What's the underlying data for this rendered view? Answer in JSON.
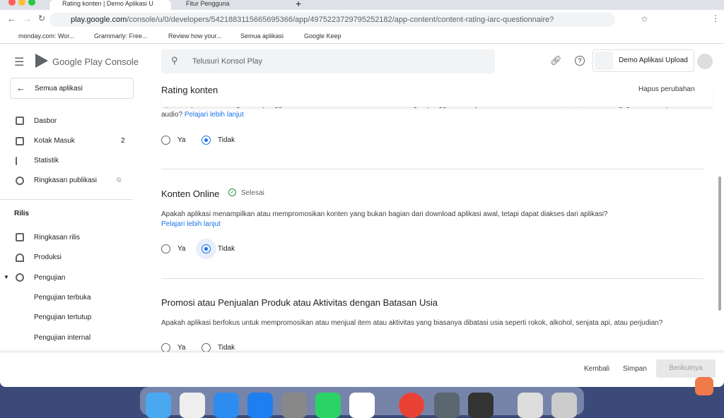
{
  "browser": {
    "tabs": [
      {
        "label": "Rating konten | Demo Aplikasi U"
      },
      {
        "label": "Fitur Pengguna"
      }
    ],
    "url_host": "play.google.com",
    "url_path": "/console/u/0/developers/5421883115665695366/app/4975223729795252182/app-content/content-rating-iarc-questionnaire?source=dashboard",
    "bookmarks": [
      "monday.com: Wor...",
      "Grammarly: Free...",
      "Review how your...",
      "Semua aplikasi",
      "Google Keep"
    ]
  },
  "header": {
    "logo": "Google Play Console",
    "search_placeholder": "Telusuri Konsol Play",
    "app_name": "Demo Aplikasi Upload"
  },
  "sidebar": {
    "back": "Semua aplikasi",
    "items": [
      {
        "label": "Dasbor",
        "icon": "dashboard-icon"
      },
      {
        "label": "Kotak Masuk",
        "badge": "2",
        "icon": "inbox-icon"
      },
      {
        "label": "Statistik",
        "icon": "bar-chart-icon"
      },
      {
        "label": "Ringkasan publikasi",
        "icon": "history-icon"
      }
    ],
    "section": "Rilis",
    "rilis": [
      {
        "label": "Ringkasan rilis"
      },
      {
        "label": "Produksi"
      },
      {
        "label": "Pengujian"
      }
    ],
    "sub": [
      "Pengujian terbuka",
      "Pengujian tertutup",
      "Pengujian internal"
    ]
  },
  "page": {
    "title": "Rating konten",
    "discard": "Hapus perubahan",
    "q1": {
      "text": "Apakah aplikasi memungkinkan pengguna berinteraksi atau bertukar konten dengan pengguna lainnya melalui komunikasi suara, teks, atau berbagi gambar maupun audio?",
      "link": "Pelajari lebih lanjut",
      "selected": "Tidak"
    },
    "s2": {
      "title": "Konten Online",
      "status": "Selesai",
      "text": "Apakah aplikasi menampilkan atau mempromosikan konten yang bukan bagian dari download aplikasi awal, tetapi dapat diakses dari aplikasi?",
      "link": "Pelajari lebih lanjut",
      "selected": "Tidak"
    },
    "s3": {
      "title": "Promosi atau Penjualan Produk atau Aktivitas dengan Batasan Usia",
      "text": "Apakah aplikasi berfokus untuk mempromosikan atau menjual item atau aktivitas yang biasanya dibatasi usia seperti rokok, alkohol, senjata api, atau perjudian?",
      "selected": null
    },
    "yes": "Ya",
    "no": "Tidak"
  },
  "footer": {
    "back": "Kembali",
    "save": "Simpan",
    "next": "Berikutnya"
  },
  "colors": {
    "accent": "#1a73e8",
    "success": "#1e8e3e"
  }
}
